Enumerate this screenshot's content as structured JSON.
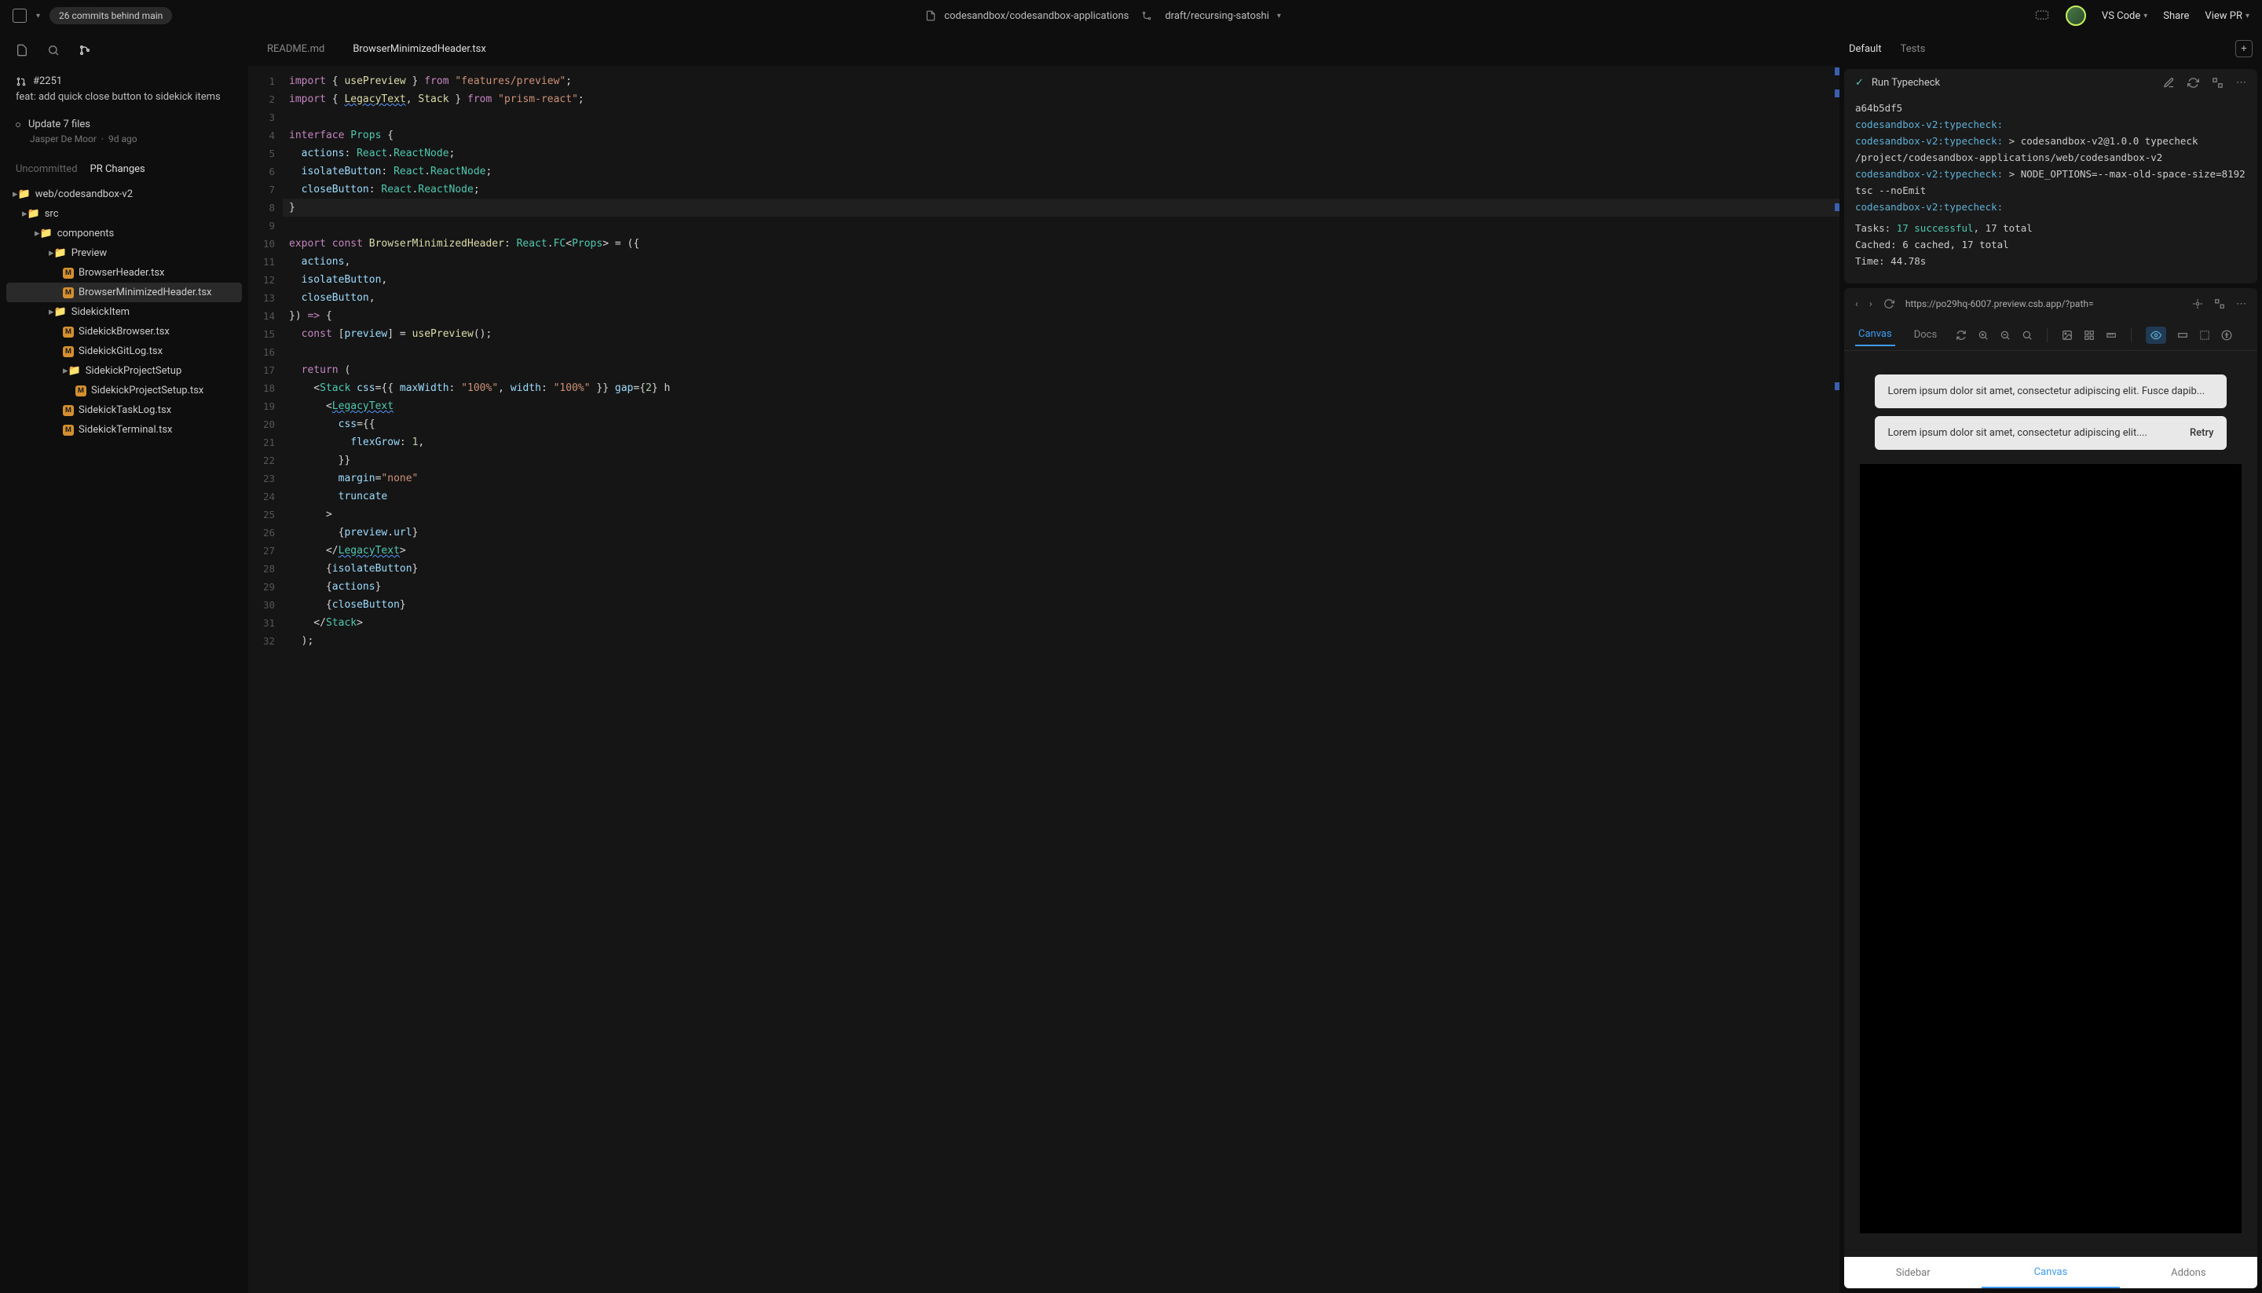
{
  "topbar": {
    "commits_label": "26 commits behind main",
    "repo": "codesandbox/codesandbox-applications",
    "branch": "draft/recursing-satoshi",
    "vscode": "VS Code",
    "share": "Share",
    "view_pr": "View PR"
  },
  "sidebar": {
    "pr": {
      "hash": "#2251",
      "desc": "feat: add quick close button to sidekick items"
    },
    "commit": {
      "title": "Update 7 files",
      "author": "Jasper De Moor",
      "age": "9d ago"
    },
    "tabs": {
      "uncommitted": "Uncommitted",
      "pr_changes": "PR Changes"
    },
    "tree": {
      "root": "web/codesandbox-v2",
      "src": "src",
      "components": "components",
      "preview_dir": "Preview",
      "files_preview": [
        "BrowserHeader.tsx",
        "BrowserMinimizedHeader.tsx"
      ],
      "sidekick_dir": "SidekickItem",
      "files_sidekick": [
        "SidekickBrowser.tsx",
        "SidekickGitLog.tsx"
      ],
      "sps_dir": "SidekickProjectSetup",
      "sps_file": "SidekickProjectSetup.tsx",
      "files_sidekick2": [
        "SidekickTaskLog.tsx",
        "SidekickTerminal.tsx"
      ]
    }
  },
  "editor": {
    "tabs": [
      "README.md",
      "BrowserMinimizedHeader.tsx"
    ],
    "line_count": 32
  },
  "right": {
    "tabs": [
      "Default",
      "Tests"
    ],
    "task": {
      "name": "Run Typecheck",
      "hash": "a64b5df5",
      "prefix": "codesandbox-v2:typecheck:",
      "line2_tail": " > codesandbox-v2@1.0.0 typecheck /project/codesandbox-applications/web/codesandbox-v2",
      "line3_tail": " > NODE_OPTIONS=--max-old-space-size=8192 tsc --noEmit",
      "tasks_label": "Tasks:",
      "tasks_success": "17 successful",
      "tasks_total": ", 17 total",
      "cached_label": "Cached:",
      "cached_val": "6 cached",
      "cached_total": ", 17 total",
      "time_label": "Time:",
      "time_val": "44.78s"
    },
    "preview": {
      "url": "https://po29hq-6007.preview.csb.app/?path=",
      "tabs": [
        "Canvas",
        "Docs"
      ],
      "toast1": "Lorem ipsum dolor sit amet, consectetur adipiscing elit. Fusce dapib...",
      "toast2": "Lorem ipsum dolor sit amet, consectetur adipiscing elit....",
      "retry": "Retry",
      "bottom": [
        "Sidebar",
        "Canvas",
        "Addons"
      ]
    }
  }
}
